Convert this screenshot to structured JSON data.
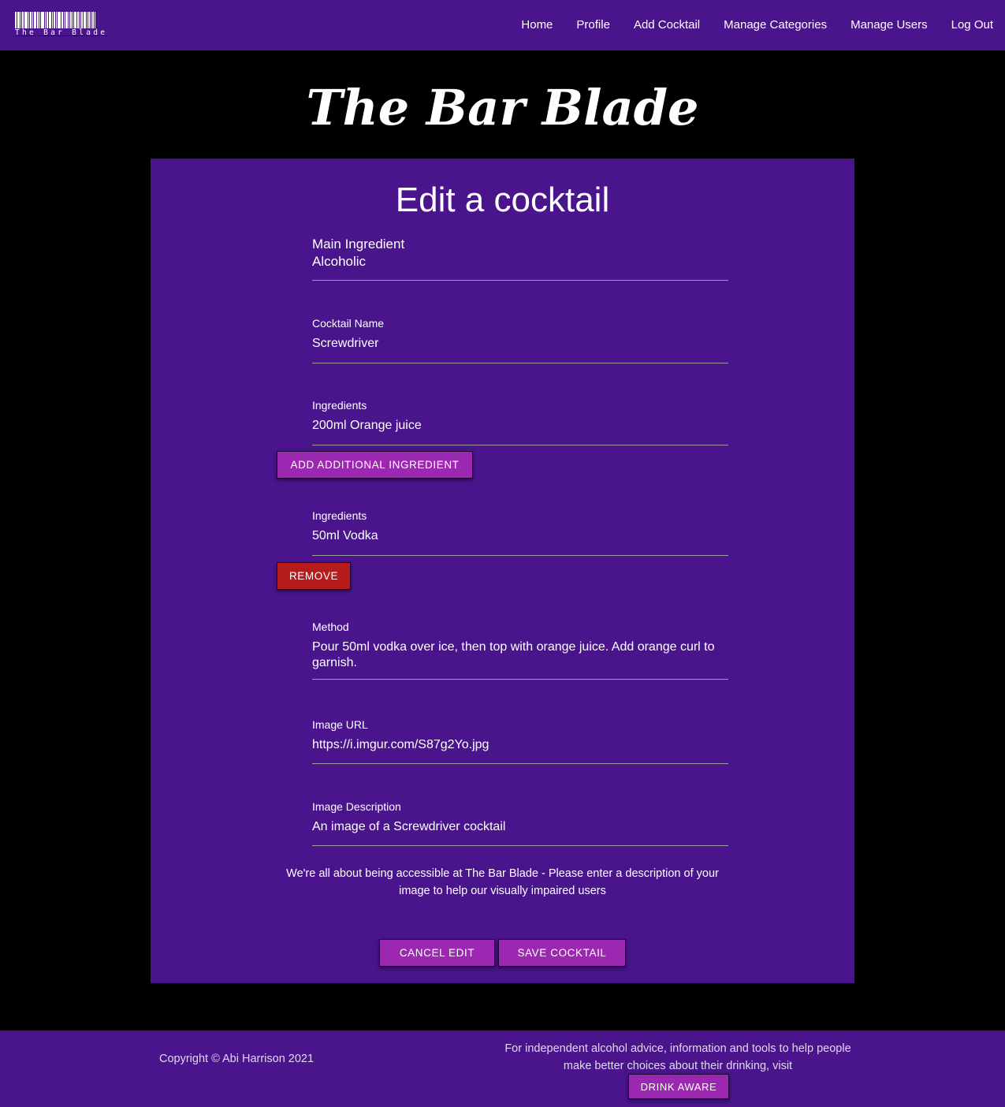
{
  "nav": {
    "brand_text": "The Bar Blade",
    "links": [
      "Home",
      "Profile",
      "Add Cocktail",
      "Manage Categories",
      "Manage Users",
      "Log Out"
    ]
  },
  "site_title": "The Bar Blade",
  "form": {
    "title": "Edit a cocktail",
    "main_ingredient_label": "Main Ingredient",
    "main_ingredient_value": "Alcoholic",
    "cocktail_name_label": "Cocktail Name",
    "cocktail_name_value": "Screwdriver",
    "ingredient1_label": "Ingredients",
    "ingredient1_value": "200ml Orange juice",
    "add_ingredient_label": "Add additional ingredient",
    "ingredient2_label": "Ingredients",
    "ingredient2_value": "50ml Vodka",
    "remove_label": "Remove",
    "method_label": "Method",
    "method_value": "Pour 50ml vodka over ice, then top with orange juice. Add orange curl to garnish.",
    "image_url_label": "Image URL",
    "image_url_value": "https://i.imgur.com/S87g2Yo.jpg",
    "image_desc_label": "Image Description",
    "image_desc_value": "An image of a Screwdriver cocktail",
    "accessibility_note": "We're all about being accessible at The Bar Blade - Please enter a description of your image to help our visually impaired users",
    "cancel_label": "Cancel Edit",
    "save_label": "Save Cocktail"
  },
  "footer": {
    "copyright": "Copyright © Abi Harrison 2021",
    "advice": "For independent alcohol advice, information and tools to help people make better choices about their drinking, visit",
    "drink_aware_label": "Drink Aware"
  },
  "colors": {
    "primary": "#4a148c",
    "button": "#9c27b0",
    "danger": "#b71c1c",
    "background": "#000000"
  }
}
